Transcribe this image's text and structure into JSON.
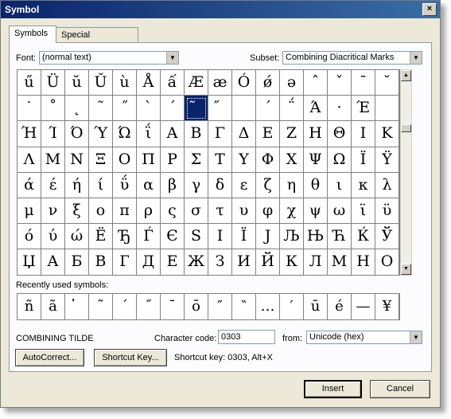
{
  "window": {
    "title": "Symbol",
    "close": "×"
  },
  "tabs": [
    {
      "label": "Symbols",
      "active": true
    },
    {
      "label": "Special Characters",
      "active": false
    }
  ],
  "font_label": "Font:",
  "font_value": "(normal text)",
  "subset_label": "Subset:",
  "subset_value": "Combining Diacritical Marks",
  "symbols": [
    "ű",
    "Ü",
    "ŭ",
    "Ǔ",
    "ù",
    "Å",
    "ấ",
    "Æ",
    "æ",
    "Ó",
    "ǿ",
    "ə",
    "ˆ",
    "ˇ",
    "¯",
    "˘",
    "˙",
    "˚",
    "˛",
    "˜",
    "˝",
    "ˋ",
    "ˊ",
    "̃",
    "̋",
    "",
    "΄",
    "΅",
    "Ά",
    "·",
    "Έ",
    "",
    "Ή",
    "Ί",
    "Ό",
    "Ύ",
    "Ώ",
    "ΐ",
    "Α",
    "Β",
    "Γ",
    "Δ",
    "Ε",
    "Ζ",
    "Η",
    "Θ",
    "Ι",
    "Κ",
    "Λ",
    "Μ",
    "Ν",
    "Ξ",
    "Ο",
    "Π",
    "Ρ",
    "Σ",
    "Τ",
    "Υ",
    "Φ",
    "Χ",
    "Ψ",
    "Ω",
    "Ϊ",
    "Ϋ",
    "ά",
    "έ",
    "ή",
    "ί",
    "ΰ",
    "α",
    "β",
    "γ",
    "δ",
    "ε",
    "ζ",
    "η",
    "θ",
    "ι",
    "κ",
    "λ",
    "μ",
    "ν",
    "ξ",
    "ο",
    "π",
    "ρ",
    "ς",
    "σ",
    "τ",
    "υ",
    "φ",
    "χ",
    "ψ",
    "ω",
    "ϊ",
    "ϋ",
    "ό",
    "ύ",
    "ώ",
    "Ё",
    "Ђ",
    "Ѓ",
    "Є",
    "Ѕ",
    "І",
    "Ї",
    "Ј",
    "Љ",
    "Њ",
    "Ћ",
    "Ќ",
    "Ў",
    "Џ",
    "А",
    "Б",
    "В",
    "Г",
    "Д",
    "Е",
    "Ж",
    "З",
    "И",
    "Й",
    "К",
    "Л",
    "М",
    "Н",
    "О"
  ],
  "selected_index": 23,
  "recent_label": "Recently used symbols:",
  "recent": [
    "ñ",
    "ã",
    "̓",
    "˜",
    "΄",
    "˝",
    "¯",
    "ō",
    "″",
    "‶",
    "…",
    "′",
    "ū",
    "é",
    "—",
    "¥"
  ],
  "char_name": "COMBINING TILDE",
  "char_code_label": "Character code:",
  "char_code_value": "0303",
  "from_label": "from:",
  "from_value": "Unicode (hex)",
  "autocorrect_label": "AutoCorrect...",
  "shortcut_key_label": "Shortcut Key...",
  "shortcut_text": "Shortcut key: 0303, Alt+X",
  "insert_label": "Insert",
  "cancel_label": "Cancel"
}
